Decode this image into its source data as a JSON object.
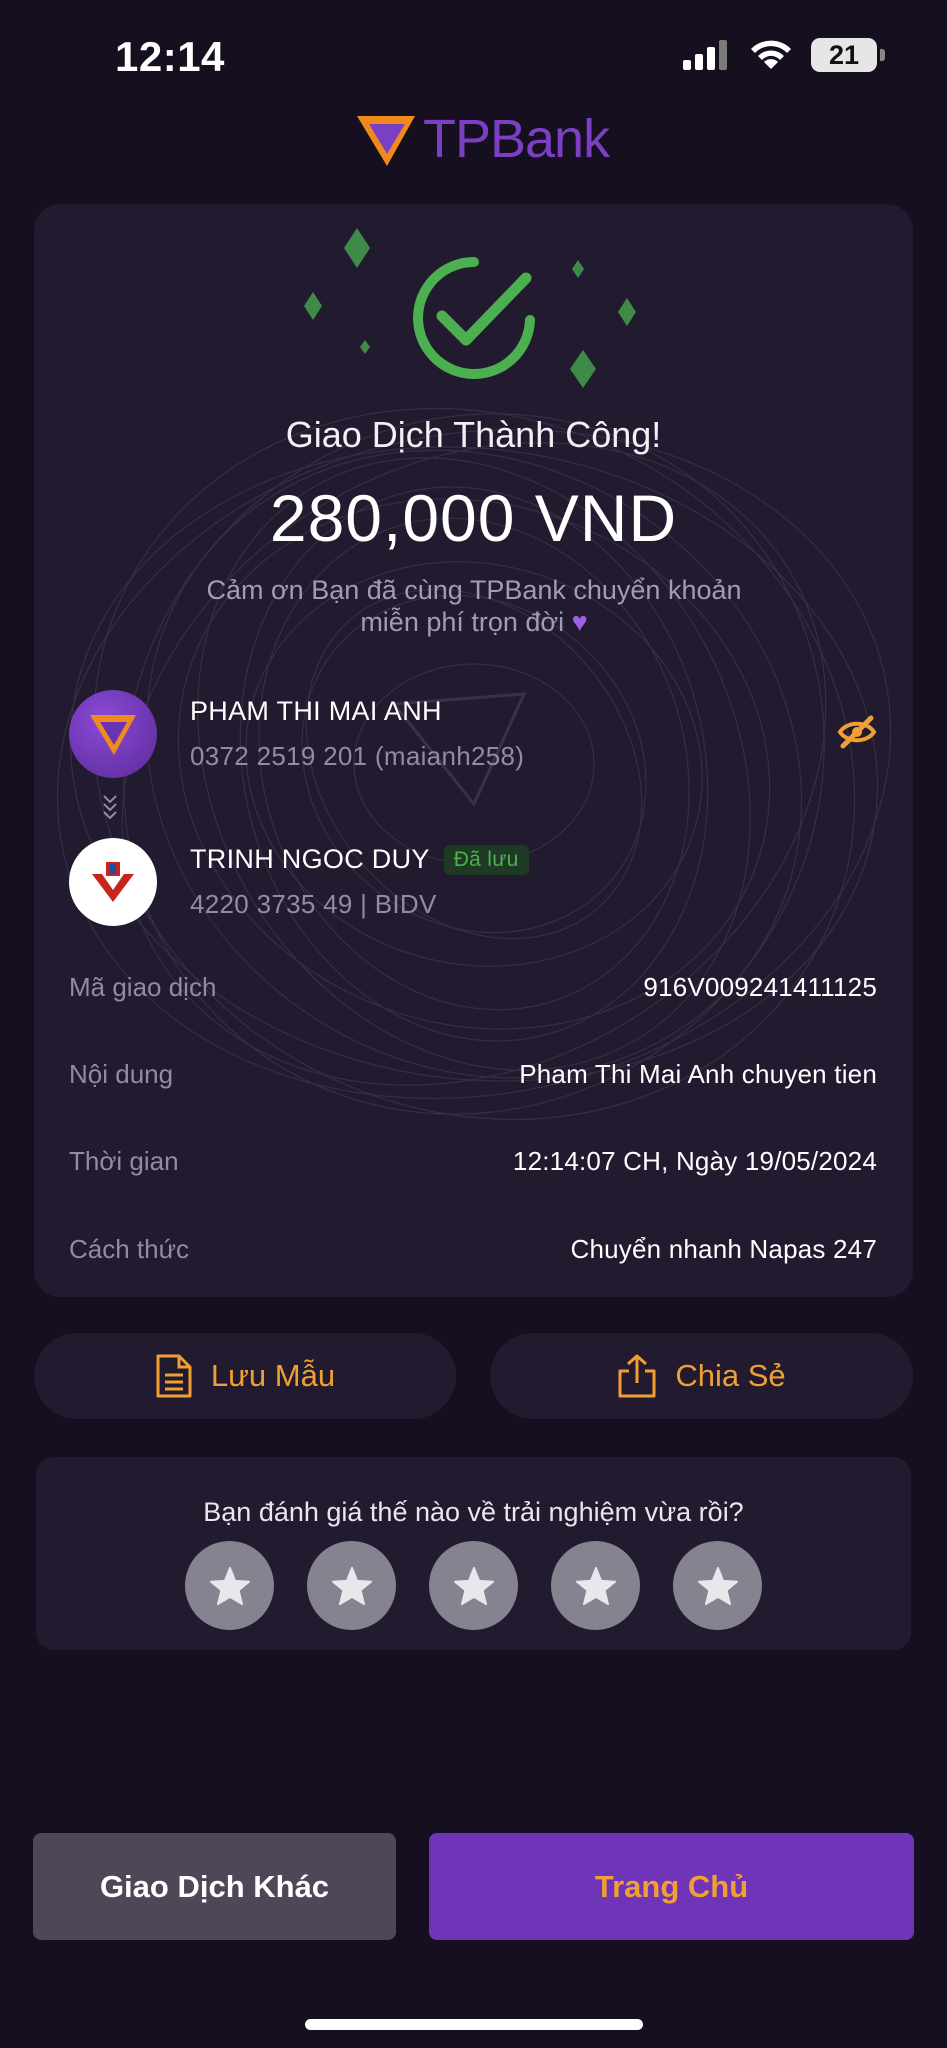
{
  "status_bar": {
    "time": "12:14",
    "battery": "21"
  },
  "logo": {
    "brand": "TPBank"
  },
  "receipt": {
    "title": "Giao Dịch Thành Công!",
    "amount": "280,000 VND",
    "thanks_line1": "Cảm ơn Bạn đã cùng TPBank chuyển khoản",
    "thanks_line2": "miễn phí trọn đời",
    "sender": {
      "name": "PHAM THI MAI ANH",
      "account": "0372 2519 201 (maianh258)"
    },
    "receiver": {
      "name": "TRINH NGOC DUY",
      "badge": "Đã lưu",
      "account": "4220 3735 49 | BIDV"
    },
    "details": [
      {
        "label": "Mã giao dịch",
        "value": "916V009241411125"
      },
      {
        "label": "Nội dung",
        "value": "Pham Thi Mai Anh chuyen tien"
      },
      {
        "label": "Thời gian",
        "value": "12:14:07 CH, Ngày 19/05/2024"
      },
      {
        "label": "Cách thức",
        "value": "Chuyển nhanh Napas 247"
      }
    ]
  },
  "actions": {
    "save_label": "Lưu Mẫu",
    "share_label": "Chia Sẻ"
  },
  "rating": {
    "question": "Bạn đánh giá thế nào về trải nghiệm vừa rồi?",
    "stars": 5
  },
  "bottom": {
    "other_label": "Giao Dịch Khác",
    "home_label": "Trang Chủ"
  },
  "colors": {
    "accent": "#f0a033",
    "brand": "#7b3fc4",
    "success": "#4caf50",
    "background": "#160f20",
    "card": "#221a2e"
  }
}
